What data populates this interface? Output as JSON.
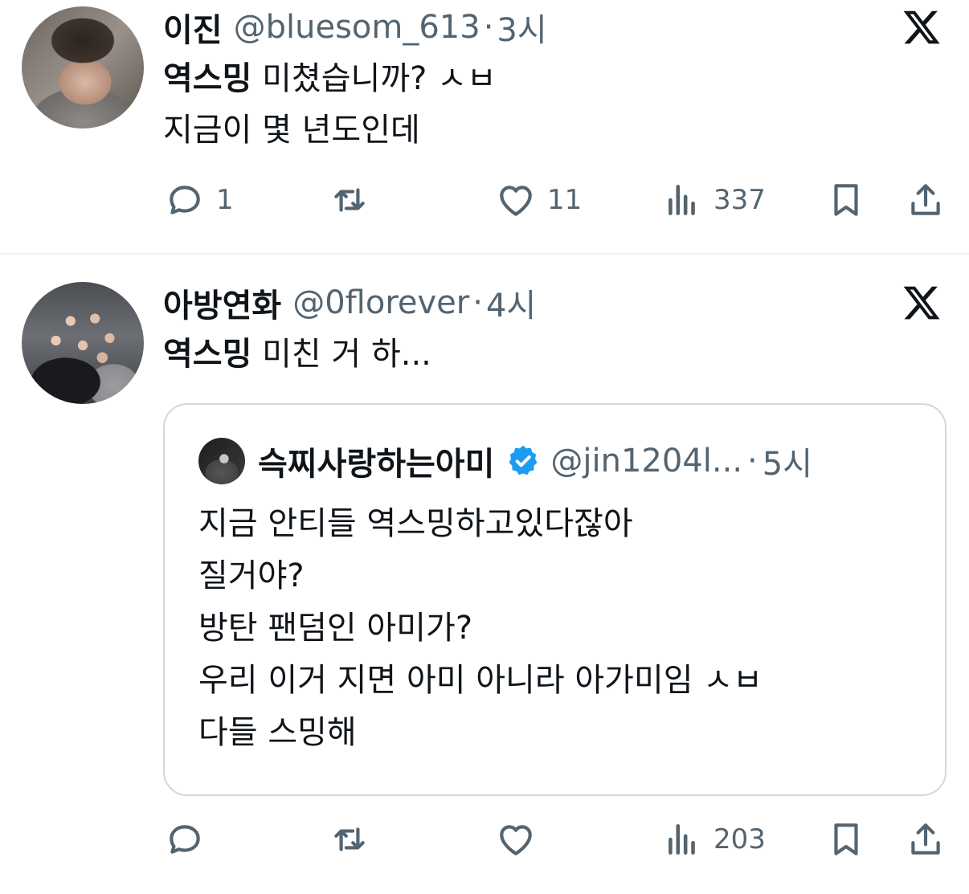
{
  "tweets": [
    {
      "author_name": "이진",
      "handle": "@bluesom_613",
      "separator": "·",
      "time": "3시",
      "avatar_icon": "user-photo",
      "text_keyword": "역스밍",
      "text_line1_rest": " 미쳤습니까? ㅅㅂ",
      "text_line2": "지금이 몇 년도인데",
      "actions": {
        "reply_count": "1",
        "retweet_count": "",
        "like_count": "11",
        "view_count": "337"
      }
    },
    {
      "author_name": "아방연화",
      "handle": "@0florever",
      "separator": "·",
      "time": "4시",
      "avatar_icon": "group-photo",
      "text_keyword": "역스밍",
      "text_line1_rest": " 미친 거 하...",
      "quote": {
        "author_name": "슥찌사랑하는아미",
        "handle": "@jin1204l...",
        "separator": "·",
        "time": "5시",
        "verified_icon": "verified-badge-icon",
        "lines": [
          "지금 안티들 역스밍하고있다잖아",
          "질거야?",
          "방탄 팬덤인 아미가?",
          "우리 이거 지면 아미 아니라 아가미임 ㅅㅂ",
          "다들 스밍해"
        ]
      },
      "actions": {
        "reply_count": "",
        "retweet_count": "",
        "like_count": "",
        "view_count": "203"
      }
    }
  ],
  "colors": {
    "text": "#0f1419",
    "secondary": "#536471",
    "border": "#cfd9de",
    "divider": "#eff3f4",
    "verified": "#1d9bf0"
  },
  "icons": [
    "reply-icon",
    "retweet-icon",
    "like-icon",
    "views-icon",
    "bookmark-icon",
    "share-icon",
    "x-logo-icon"
  ]
}
